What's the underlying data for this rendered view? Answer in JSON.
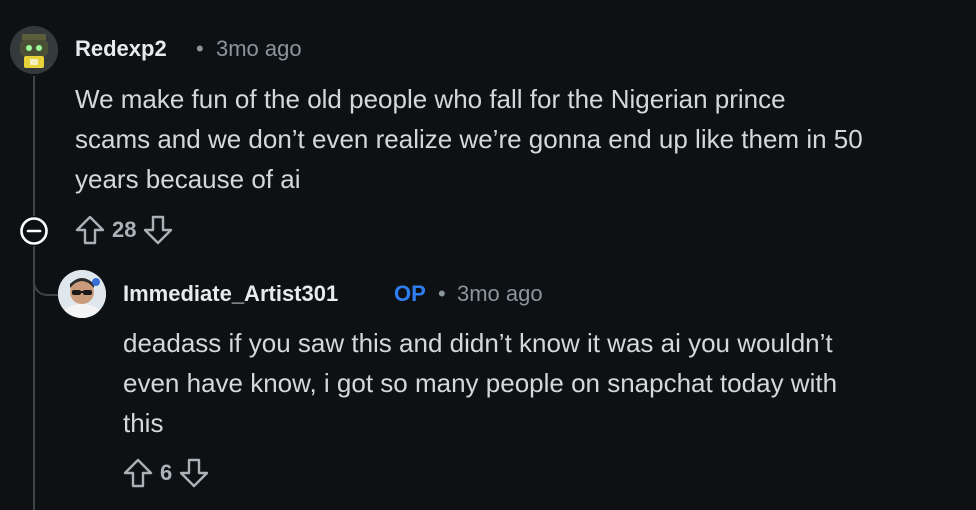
{
  "comments": [
    {
      "author": "Redexp2",
      "separator": "•",
      "time": "3mo ago",
      "body_lines": [
        "We make fun of the old people who fall for the Nigerian prince",
        "scams and we don’t even realize we’re gonna end up like them in 50",
        "years because of ai"
      ],
      "score": "28",
      "avatar_icon": "robot-avatar-icon"
    },
    {
      "author": "Immediate_Artist301",
      "badge": "OP",
      "separator": "•",
      "time": "3mo ago",
      "body_lines": [
        "deadass if you saw this and didn’t know it was ai you wouldn’t",
        "even have know, i got so many people on snapchat today with",
        "this"
      ],
      "score": "6",
      "avatar_icon": "person-avatar-icon"
    }
  ],
  "colors": {
    "background": "#0e1113",
    "author": "#e8eaeb",
    "meta": "#8a959c",
    "body": "#d4d8da",
    "op_badge": "#2f7ef0",
    "thread_line": "#3e4447"
  }
}
